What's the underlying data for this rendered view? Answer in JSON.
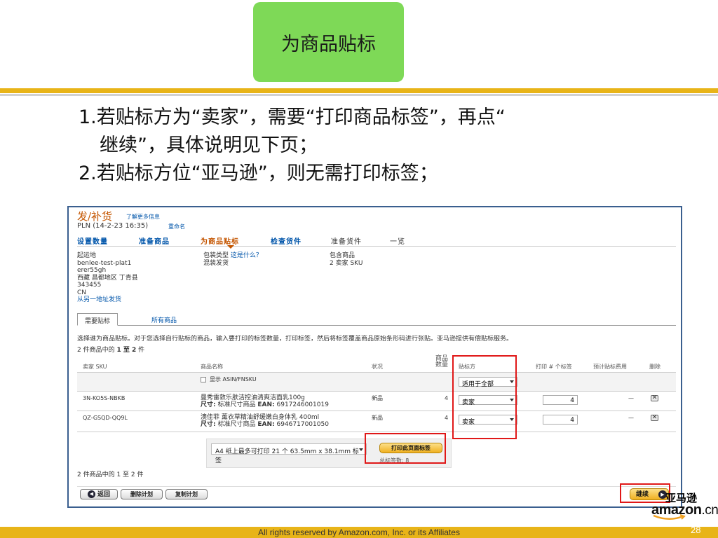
{
  "slide": {
    "title": "为商品贴标",
    "bullet1_line1": "1.若贴标方为“卖家”，需要“打印商品标签”，再点“",
    "bullet1_line2": "继续”，具体说明见下页；",
    "bullet2": "2.若贴标方位“亚马逊”，则无需打印标签；",
    "footer": "All rights reserved by Amazon.com, Inc. or its Affiliates",
    "page_number": "28",
    "logo_cn": "亚马逊",
    "logo_word": "amazon",
    "logo_suffix": ".cn",
    "colors": {
      "title_bg": "#7ed957",
      "accent_bar": "#e8b418",
      "highlight": "#e01818"
    }
  },
  "shot": {
    "header": {
      "title": "发/补货",
      "learn_more": "了解更多信息",
      "plan": "PLN (14-2-23 16:35)",
      "rename": "重命名"
    },
    "steps": [
      "设置数量",
      "准备商品",
      "为商品贴标",
      "检查货件",
      "准备货件",
      "一览"
    ],
    "active_step": "为商品贴标",
    "ship_from": {
      "label": "起运地",
      "lines": [
        "benlee-test-plat1",
        "erer55gh",
        "西藏 昌都地区 丁青县",
        "343455",
        "CN"
      ],
      "link": "从另一地址发货"
    },
    "packing": {
      "label": "包装类型",
      "link": "这是什么？",
      "value": "混装发货"
    },
    "contents": {
      "label": "包含商品",
      "value": "2 卖家 SKU"
    },
    "tabs": {
      "active": "需要贴标",
      "other": "所有商品"
    },
    "description": "选择谁为商品贴标。对于您选择自行贴标的商品，输入要打印的标签数量，打印标签，然后将标签覆盖商品原始条形码进行张贴。亚马逊提供有偿贴标服务。",
    "count_prefix": "2 件商品中的",
    "count_range": "1 至 2",
    "count_suffix": "件",
    "count_bottom": "2 件商品中的 1 至 2 件",
    "columns": {
      "sku": "卖家 SKU",
      "name": "商品名称",
      "condition": "状况",
      "qty_line1": "商品",
      "qty_line2": "数量",
      "labeler": "贴标方",
      "print": "打印 # 个标签",
      "fee": "预计贴标费用",
      "remove": "删除"
    },
    "filter": {
      "show_asin": "显示 ASIN/FNSKU",
      "apply_all": "适用于全部"
    },
    "rows": [
      {
        "sku": "3N-KO5S-NBKB",
        "name": "曼秀雷敦乐肤洁控油清爽洁面乳100g",
        "size_label": "尺寸:",
        "size_value": "标准尺寸商品",
        "ean_label": "EAN:",
        "ean": "6917246001019",
        "condition": "新品",
        "qty": "4",
        "labeler": "卖家",
        "print_qty": "4",
        "fee": "—",
        "remove": "✕"
      },
      {
        "sku": "QZ-GSQD-QQ9L",
        "name": "澳佳菲 薰衣草精油舒缓嫩白身体乳 400ml",
        "size_label": "尺寸:",
        "size_value": "标准尺寸商品",
        "ean_label": "EAN:",
        "ean": "6946717001050",
        "condition": "新品",
        "qty": "4",
        "labeler": "卖家",
        "print_qty": "4",
        "fee": "—",
        "remove": "✕"
      }
    ],
    "print": {
      "paper": "A4 纸上最多可打印 21 个 63.5mm x 38.1mm 标签",
      "button": "打印此页面标签",
      "total": "总标签数: 8"
    },
    "buttons": {
      "back": "返回",
      "delete": "删除计划",
      "copy": "复制计划",
      "continue": "继续"
    }
  }
}
